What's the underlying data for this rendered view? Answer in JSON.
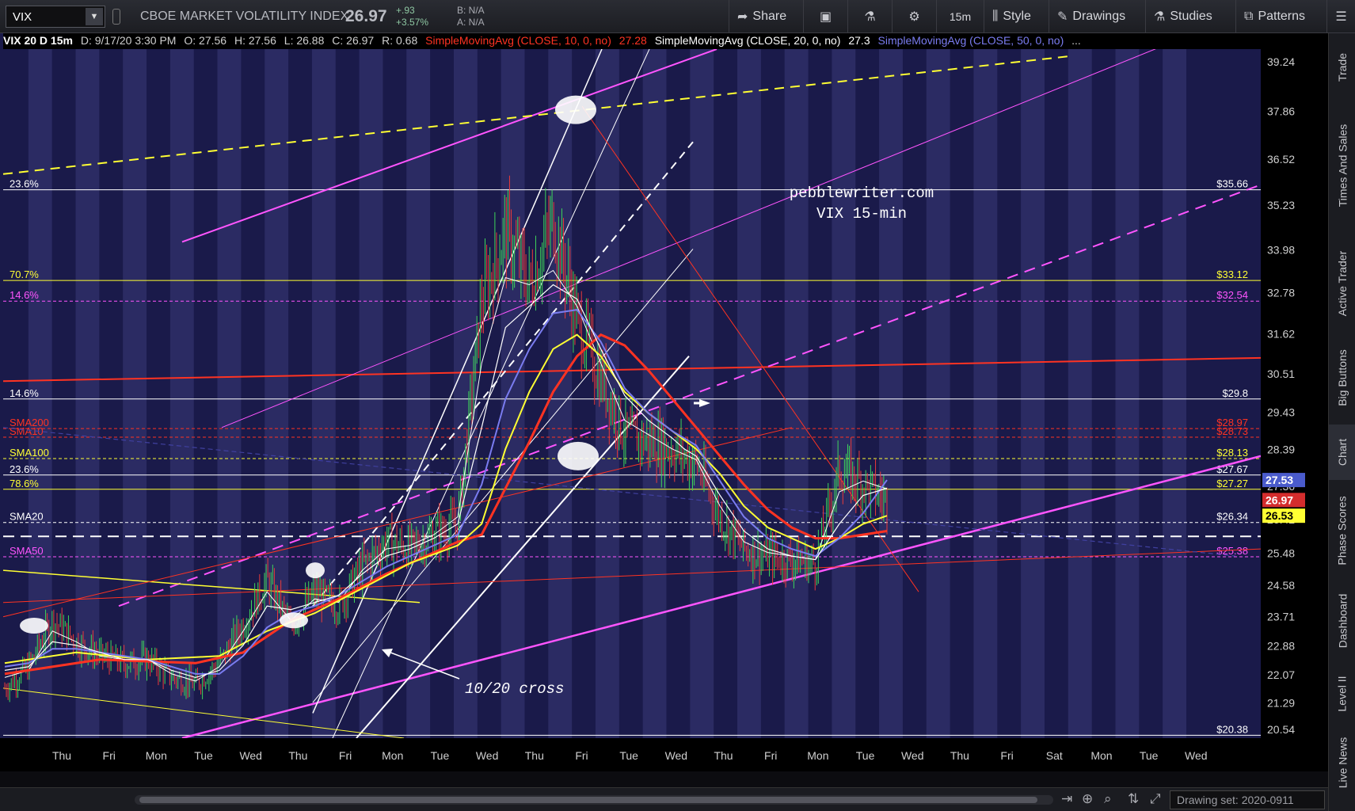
{
  "toolbar": {
    "symbol": "VIX",
    "description": "CBOE MARKET VOLATILITY INDEX",
    "last": "26.97",
    "change_abs": "+.93",
    "change_pct": "+3.57%",
    "bid": "B: N/A",
    "ask": "A: N/A",
    "share": "Share",
    "timeframe": "15m",
    "style": "Style",
    "drawings": "Drawings",
    "studies": "Studies",
    "patterns": "Patterns"
  },
  "legend": {
    "title": "VIX 20 D 15m",
    "date": "D: 9/17/20 3:30 PM",
    "open": "O: 27.56",
    "high": "H: 27.56",
    "low": "L: 26.88",
    "close": "C: 26.97",
    "range": "R: 0.68",
    "sma10_label": "SimpleMovingAvg (CLOSE, 10, 0, no)",
    "sma10_value": "27.28",
    "sma20_label": "SimpleMovingAvg (CLOSE, 20, 0, no)",
    "sma20_value": "27.3",
    "sma50_label": "SimpleMovingAvg (CLOSE, 50, 0, no)",
    "more": "..."
  },
  "annotations": {
    "site": "pebblewriter.com",
    "chart_name": "VIX 15-min",
    "cross": "10/20 cross"
  },
  "right_tabs": [
    "Trade",
    "Times And Sales",
    "Active Trader",
    "Big Buttons",
    "Chart",
    "Phase Scores",
    "Dashboard",
    "Level II",
    "Live News"
  ],
  "status": {
    "drawing_set": "Drawing set: 2020-0911"
  },
  "chart_data": {
    "type": "candlestick",
    "interval": "15m",
    "y_range": [
      20.3,
      39.6
    ],
    "y_ticks": [
      20.54,
      21.29,
      22.07,
      22.88,
      23.71,
      24.58,
      25.48,
      26.42,
      27.36,
      28.39,
      29.43,
      30.51,
      31.62,
      32.78,
      33.98,
      35.23,
      36.52,
      37.86,
      39.24
    ],
    "x_labels": [
      "Thu",
      "Fri",
      "Mon",
      "Tue",
      "Wed",
      "Thu",
      "Fri",
      "Mon",
      "Tue",
      "Wed",
      "Thu",
      "Fri",
      "Tue",
      "Wed",
      "Thu",
      "Fri",
      "Mon",
      "Tue",
      "Wed",
      "Thu",
      "Fri",
      "Sat",
      "Mon",
      "Tue",
      "Wed"
    ],
    "price_path": [
      [
        0,
        21.7
      ],
      [
        1,
        22.3
      ],
      [
        2,
        23.6
      ],
      [
        3,
        23.0
      ],
      [
        4,
        22.6
      ],
      [
        5,
        22.4
      ],
      [
        6,
        22.5
      ],
      [
        7,
        22.0
      ],
      [
        8,
        21.8
      ],
      [
        9,
        22.4
      ],
      [
        10,
        23.5
      ],
      [
        11,
        24.7
      ],
      [
        12,
        23.4
      ],
      [
        13,
        24.4
      ],
      [
        14,
        24.0
      ],
      [
        15,
        25.1
      ],
      [
        16,
        25.8
      ],
      [
        17,
        25.6
      ],
      [
        18,
        26.0
      ],
      [
        19,
        26.3
      ],
      [
        20,
        32.5
      ],
      [
        21,
        34.5
      ],
      [
        22,
        33.0
      ],
      [
        23,
        34.8
      ],
      [
        24,
        32.0
      ],
      [
        25,
        30.4
      ],
      [
        26,
        28.8
      ],
      [
        27,
        28.6
      ],
      [
        28,
        28.4
      ],
      [
        29,
        28.0
      ],
      [
        30,
        26.5
      ],
      [
        31,
        25.6
      ],
      [
        32,
        25.4
      ],
      [
        33,
        25.3
      ],
      [
        34,
        25.2
      ],
      [
        35,
        27.8
      ],
      [
        36,
        27.4
      ],
      [
        37,
        26.97
      ]
    ],
    "sma10": [
      [
        0,
        22.0
      ],
      [
        1,
        22.2
      ],
      [
        2,
        23.3
      ],
      [
        3,
        23.0
      ],
      [
        4,
        22.6
      ],
      [
        5,
        22.5
      ],
      [
        6,
        22.5
      ],
      [
        7,
        22.1
      ],
      [
        8,
        21.9
      ],
      [
        9,
        22.3
      ],
      [
        10,
        23.3
      ],
      [
        11,
        24.4
      ],
      [
        12,
        23.6
      ],
      [
        13,
        24.2
      ],
      [
        14,
        24.1
      ],
      [
        15,
        25.0
      ],
      [
        16,
        25.6
      ],
      [
        17,
        25.7
      ],
      [
        18,
        26.0
      ],
      [
        19,
        26.5
      ],
      [
        20,
        30.8
      ],
      [
        21,
        33.2
      ],
      [
        22,
        33.0
      ],
      [
        23,
        33.4
      ],
      [
        24,
        32.4
      ],
      [
        25,
        30.8
      ],
      [
        26,
        29.2
      ],
      [
        27,
        28.8
      ],
      [
        28,
        28.4
      ],
      [
        29,
        28.1
      ],
      [
        30,
        26.8
      ],
      [
        31,
        25.8
      ],
      [
        32,
        25.5
      ],
      [
        33,
        25.4
      ],
      [
        34,
        25.3
      ],
      [
        35,
        27.2
      ],
      [
        36,
        27.5
      ],
      [
        37,
        27.28
      ]
    ],
    "sma20": [
      [
        0,
        22.2
      ],
      [
        1,
        22.3
      ],
      [
        2,
        23.0
      ],
      [
        3,
        22.9
      ],
      [
        4,
        22.7
      ],
      [
        5,
        22.5
      ],
      [
        6,
        22.5
      ],
      [
        7,
        22.2
      ],
      [
        8,
        22.0
      ],
      [
        9,
        22.2
      ],
      [
        10,
        22.9
      ],
      [
        11,
        24.0
      ],
      [
        12,
        23.9
      ],
      [
        13,
        24.1
      ],
      [
        14,
        24.3
      ],
      [
        15,
        24.9
      ],
      [
        16,
        25.4
      ],
      [
        17,
        25.6
      ],
      [
        18,
        25.9
      ],
      [
        19,
        26.3
      ],
      [
        20,
        29.0
      ],
      [
        21,
        31.8
      ],
      [
        22,
        32.4
      ],
      [
        23,
        33.0
      ],
      [
        24,
        32.6
      ],
      [
        25,
        31.2
      ],
      [
        26,
        29.9
      ],
      [
        27,
        29.2
      ],
      [
        28,
        28.7
      ],
      [
        28.5,
        28.4
      ],
      [
        29,
        28.2
      ],
      [
        30,
        27.1
      ],
      [
        31,
        26.1
      ],
      [
        32,
        25.6
      ],
      [
        33,
        25.4
      ],
      [
        34,
        25.3
      ],
      [
        35,
        26.3
      ],
      [
        36,
        27.1
      ],
      [
        37,
        27.3
      ]
    ],
    "sma50": [
      [
        0,
        22.3
      ],
      [
        1,
        22.4
      ],
      [
        2,
        22.8
      ],
      [
        3,
        22.8
      ],
      [
        4,
        22.7
      ],
      [
        5,
        22.6
      ],
      [
        6,
        22.5
      ],
      [
        7,
        22.3
      ],
      [
        8,
        22.1
      ],
      [
        9,
        22.1
      ],
      [
        10,
        22.6
      ],
      [
        11,
        23.4
      ],
      [
        12,
        23.8
      ],
      [
        13,
        24.0
      ],
      [
        14,
        24.3
      ],
      [
        15,
        24.7
      ],
      [
        16,
        25.1
      ],
      [
        17,
        25.4
      ],
      [
        18,
        25.7
      ],
      [
        19,
        26.0
      ],
      [
        20,
        27.4
      ],
      [
        21,
        29.8
      ],
      [
        22,
        31.2
      ],
      [
        23,
        32.2
      ],
      [
        24,
        32.3
      ],
      [
        25,
        31.4
      ],
      [
        26,
        30.1
      ],
      [
        27,
        29.4
      ],
      [
        28,
        28.9
      ],
      [
        29,
        28.5
      ],
      [
        30,
        27.5
      ],
      [
        31,
        26.5
      ],
      [
        32,
        25.9
      ],
      [
        33,
        25.6
      ],
      [
        34,
        25.4
      ],
      [
        35,
        25.9
      ],
      [
        36,
        26.6
      ],
      [
        37,
        27.53
      ]
    ],
    "sma100": [
      [
        0,
        22.4
      ],
      [
        3,
        22.7
      ],
      [
        6,
        22.5
      ],
      [
        9,
        22.6
      ],
      [
        11,
        23.3
      ],
      [
        13,
        23.8
      ],
      [
        15,
        24.5
      ],
      [
        17,
        25.2
      ],
      [
        19,
        25.7
      ],
      [
        20,
        26.3
      ],
      [
        21,
        28.4
      ],
      [
        22,
        30.0
      ],
      [
        23,
        31.2
      ],
      [
        24,
        31.6
      ],
      [
        25,
        31.0
      ],
      [
        26,
        30.0
      ],
      [
        27,
        29.4
      ],
      [
        28,
        28.9
      ],
      [
        29,
        28.4
      ],
      [
        30,
        27.7
      ],
      [
        31,
        26.8
      ],
      [
        32,
        26.2
      ],
      [
        33,
        25.9
      ],
      [
        34,
        25.6
      ],
      [
        35,
        25.9
      ],
      [
        36,
        26.3
      ],
      [
        37,
        26.53
      ]
    ],
    "sma200": [
      [
        0,
        22.1
      ],
      [
        4,
        22.5
      ],
      [
        8,
        22.4
      ],
      [
        10,
        22.7
      ],
      [
        12,
        23.6
      ],
      [
        14,
        24.2
      ],
      [
        16,
        24.9
      ],
      [
        18,
        25.5
      ],
      [
        19,
        25.8
      ],
      [
        20,
        26.0
      ],
      [
        21,
        27.3
      ],
      [
        22,
        28.6
      ],
      [
        23,
        30.0
      ],
      [
        24,
        31.0
      ],
      [
        25,
        31.6
      ],
      [
        26,
        31.3
      ],
      [
        27,
        30.6
      ],
      [
        28,
        29.8
      ],
      [
        29,
        29.0
      ],
      [
        30,
        28.2
      ],
      [
        31,
        27.4
      ],
      [
        32,
        26.7
      ],
      [
        33,
        26.2
      ],
      [
        34,
        25.9
      ],
      [
        35,
        25.9
      ],
      [
        36,
        26.0
      ],
      [
        37,
        26.1
      ]
    ],
    "horizontal_levels": [
      {
        "price": 35.66,
        "label_left": "23.6%",
        "label_right": "$35.66",
        "color": "#ffffff"
      },
      {
        "price": 33.12,
        "label_left": "70.7%",
        "label_right": "$33.12",
        "color": "#ffff33"
      },
      {
        "price": 32.54,
        "label_left": "14.6%",
        "label_right": "$32.54",
        "color": "#ff55ff",
        "dash": true
      },
      {
        "price": 29.8,
        "label_left": "14.6%",
        "label_right": "$29.8",
        "color": "#ffffff"
      },
      {
        "price": 28.97,
        "label_left": "SMA200",
        "label_right": "$28.97",
        "color": "#ff3322",
        "dash": true
      },
      {
        "price": 28.73,
        "label_left": "SMA10",
        "label_right": "$28.73",
        "color": "#ff3322",
        "dash": true
      },
      {
        "price": 28.13,
        "label_left": "SMA100",
        "label_right": "$28.13",
        "color": "#ffff33",
        "dash": true
      },
      {
        "price": 27.67,
        "label_left": "23.6%",
        "label_right": "$27.67",
        "color": "#ffffff"
      },
      {
        "price": 27.27,
        "label_left": "78.6%",
        "label_right": "$27.27",
        "color": "#ffff33"
      },
      {
        "price": 26.34,
        "label_left": "SMA20",
        "label_right": "$26.34",
        "color": "#ffffff",
        "dash": true
      },
      {
        "price": 25.38,
        "label_left": "SMA50",
        "label_right": "$25.38",
        "color": "#ff55ff",
        "dash": true
      },
      {
        "price": 20.38,
        "label_left": "",
        "label_right": "$20.38",
        "color": "#ffffff"
      }
    ],
    "price_tags": [
      {
        "value": "27.53",
        "bg": "#4a5bcc",
        "fg": "#ffffff"
      },
      {
        "value": "26.97",
        "bg": "#d42d2d",
        "fg": "#ffffff"
      },
      {
        "value": "26.53",
        "bg": "#ffff33",
        "fg": "#000000"
      }
    ]
  }
}
